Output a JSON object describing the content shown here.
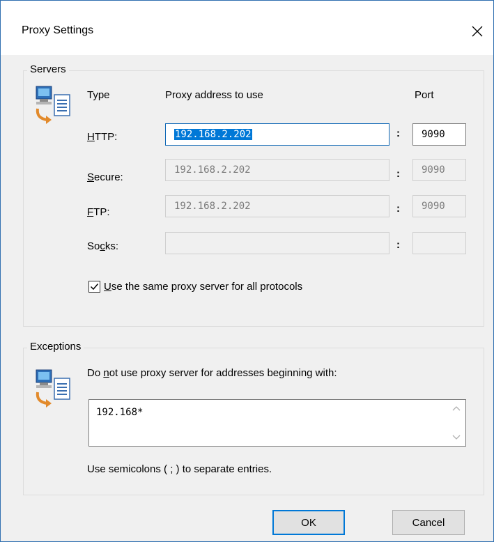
{
  "window": {
    "title": "Proxy Settings"
  },
  "servers": {
    "group_label": "Servers",
    "headers": {
      "type": "Type",
      "address": "Proxy address to use",
      "port": "Port"
    },
    "rows": [
      {
        "label_pre": "",
        "label_u": "H",
        "label_post": "TTP:",
        "address": "192.168.2.202",
        "port": "9090"
      },
      {
        "label_pre": "",
        "label_u": "S",
        "label_post": "ecure:",
        "address": "192.168.2.202",
        "port": "9090"
      },
      {
        "label_pre": "",
        "label_u": "F",
        "label_post": "TP:",
        "address": "192.168.2.202",
        "port": "9090"
      },
      {
        "label_pre": "So",
        "label_u": "c",
        "label_post": "ks:",
        "address": "",
        "port": ""
      }
    ],
    "colon": ":",
    "same_proxy": {
      "checked": true,
      "label_u": "U",
      "label_rest": "se the same proxy server for all protocols"
    }
  },
  "exceptions": {
    "group_label": "Exceptions",
    "desc_pre": "Do ",
    "desc_u": "n",
    "desc_post": "ot use proxy server for addresses beginning with:",
    "value": "192.168*",
    "hint": "Use semicolons ( ; ) to separate entries."
  },
  "buttons": {
    "ok": "OK",
    "cancel": "Cancel"
  },
  "icons": {
    "network": "network-computer-icon",
    "close": "close-icon",
    "check": "checkmark-icon"
  }
}
